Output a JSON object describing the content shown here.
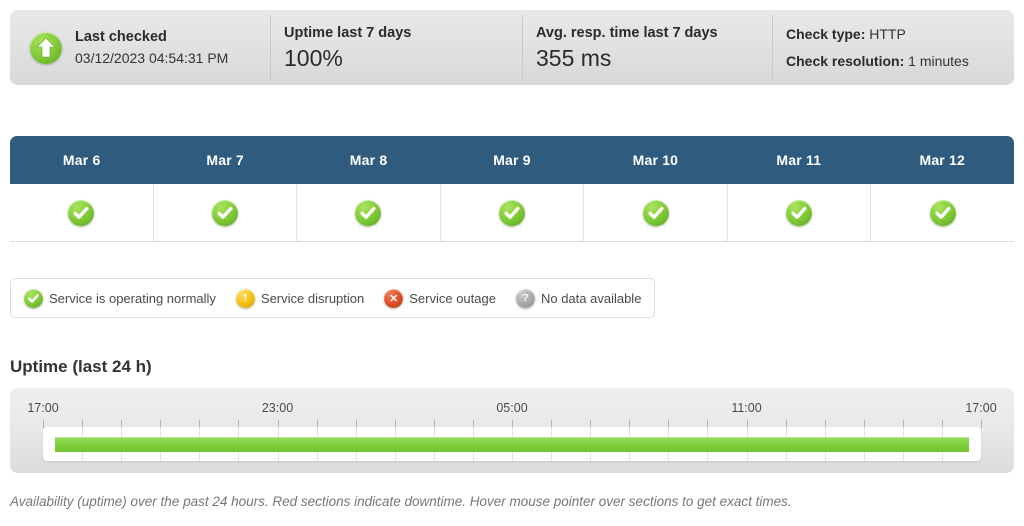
{
  "summary": {
    "last_checked": {
      "icon": "up-arrow-icon",
      "label": "Last checked",
      "value": "03/12/2023 04:54:31 PM"
    },
    "uptime": {
      "label": "Uptime last 7 days",
      "value": "100%"
    },
    "response_time": {
      "label": "Avg. resp. time last 7 days",
      "value": "355 ms"
    },
    "meta": {
      "check_type_label": "Check type:",
      "check_type_value": "HTTP",
      "check_resolution_label": "Check resolution:",
      "check_resolution_value": "1 minutes"
    }
  },
  "days_table": {
    "columns": [
      {
        "label": "Mar 6",
        "status": "ok"
      },
      {
        "label": "Mar 7",
        "status": "ok"
      },
      {
        "label": "Mar 8",
        "status": "ok"
      },
      {
        "label": "Mar 9",
        "status": "ok"
      },
      {
        "label": "Mar 10",
        "status": "ok"
      },
      {
        "label": "Mar 11",
        "status": "ok"
      },
      {
        "label": "Mar 12",
        "status": "ok"
      }
    ]
  },
  "legend": {
    "items": [
      {
        "status": "ok",
        "icon": "check-circle-icon",
        "label": "Service is operating normally"
      },
      {
        "status": "warn",
        "icon": "warning-circle-icon",
        "label": "Service disruption"
      },
      {
        "status": "out",
        "icon": "x-circle-icon",
        "label": "Service outage"
      },
      {
        "status": "none",
        "icon": "question-circle-icon",
        "label": "No data available"
      }
    ]
  },
  "uptime_chart": {
    "title": "Uptime (last 24 h)",
    "caption": "Availability (uptime) over the past 24 hours. Red sections indicate downtime. Hover mouse pointer over sections to get exact times."
  },
  "chart_data": {
    "type": "bar",
    "title": "Uptime (last 24 h)",
    "xlabel": "",
    "ylabel": "",
    "grid": true,
    "legend_position": "above",
    "axis_tick_labels": [
      "17:00",
      "23:00",
      "05:00",
      "11:00",
      "17:00"
    ],
    "axis_tick_positions_pct": [
      0,
      25,
      50,
      75,
      100
    ],
    "minor_tick_interval_hours": 1,
    "minor_tick_count": 25,
    "x_range_hours": [
      0,
      24
    ],
    "segments": [
      {
        "state": "up",
        "start_pct": 0,
        "end_pct": 100,
        "color": "#7ccd3c",
        "label": "Service is operating normally"
      }
    ],
    "uptime_pct": 100
  },
  "colors": {
    "accent_blue": "#2f5b7e",
    "ok_green": "#7ccd3c",
    "warn_yellow": "#f6c316",
    "outage_red": "#e2512a",
    "nodata_gray": "#ababab",
    "panel_gray": "#e4e4e4"
  }
}
